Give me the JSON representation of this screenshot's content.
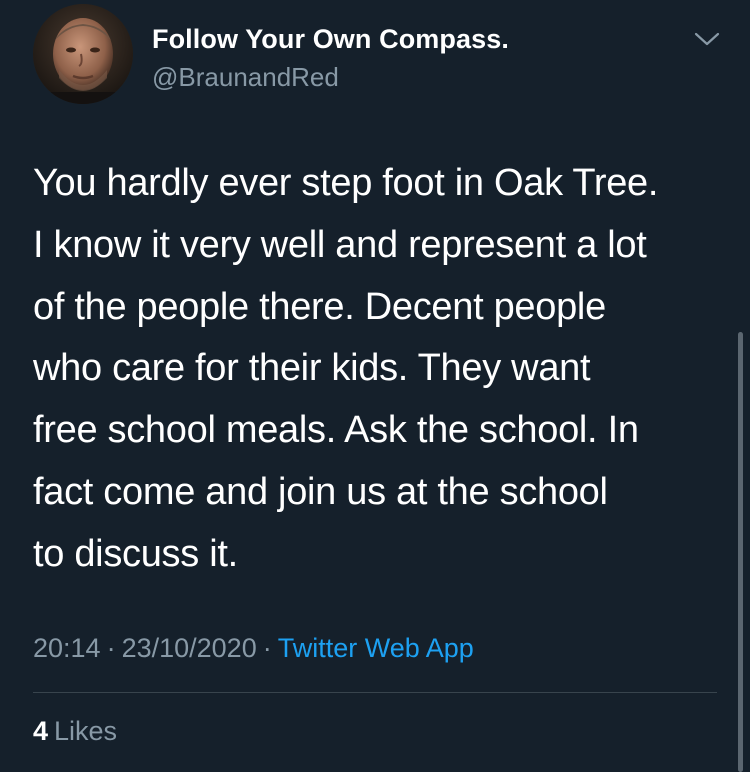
{
  "author": {
    "display_name": "Follow Your Own Compass.",
    "handle": "@BraunandRed",
    "avatar_icon": "profile-photo"
  },
  "tweet": {
    "text": "You hardly ever step foot in Oak Tree.\nI know it very well and represent a lot\nof the people there. Decent people\nwho care for their kids. They want\nfree school meals. Ask the school. In\nfact come and join us at the school\nto discuss it.",
    "time": "20:14",
    "separator": "·",
    "date": "23/10/2020",
    "source_app": "Twitter Web App"
  },
  "engagement": {
    "likes_count": "4",
    "likes_label": "Likes"
  },
  "icons": {
    "more_menu": "chevron-down-icon"
  },
  "colors": {
    "background": "#15202b",
    "secondary_text": "#8899a6",
    "link": "#1da1f2"
  }
}
